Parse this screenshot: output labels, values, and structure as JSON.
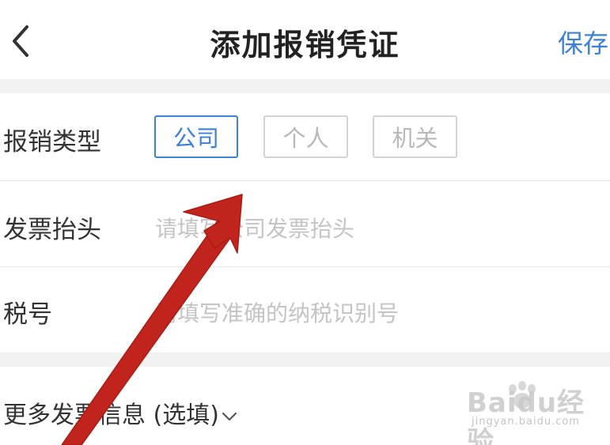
{
  "header": {
    "title": "添加报销凭证",
    "save_label": "保存",
    "back_icon": "chevron-left-icon"
  },
  "form": {
    "reimburse_type": {
      "label": "报销类型",
      "options": [
        "公司",
        "个人",
        "机关"
      ],
      "selected": "公司"
    },
    "invoice_title": {
      "label": "发票抬头",
      "placeholder": "请填写公司发票抬头"
    },
    "tax_number": {
      "label": "税号",
      "placeholder": "请填写准确的纳税识别号"
    },
    "more_info": {
      "label": "更多发票信息 (选填)",
      "icon": "chevron-down-icon"
    }
  },
  "watermark": {
    "brand": "Baidu经验",
    "url": "jingyan.baidu.com"
  },
  "colors": {
    "accent": "#3b82d6",
    "arrow": "#c0241c",
    "separator": "#f2f2f2",
    "placeholder": "#c4c4c4"
  }
}
